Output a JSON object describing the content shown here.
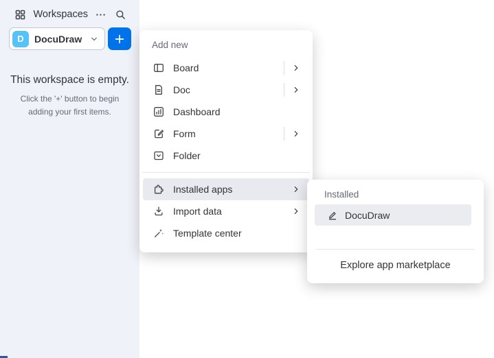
{
  "colors": {
    "accent_blue": "#0073ea",
    "avatar_blue": "#55c2f8",
    "sidebar_bg": "#eff2f8",
    "text_dark": "#323338",
    "text_gray": "#676879",
    "highlight_row": "#e9eaef"
  },
  "sidebar": {
    "workspaces_label": "Workspaces",
    "workspace_switcher": {
      "avatar_letter": "D",
      "name": "DocuDraw"
    },
    "empty_state": {
      "title": "This workspace is empty.",
      "subtitle_line1": "Click the '+' button to begin",
      "subtitle_line2": "adding your first items."
    }
  },
  "add_menu": {
    "header": "Add new",
    "items": [
      {
        "label": "Board",
        "icon": "board-icon",
        "has_submenu": true
      },
      {
        "label": "Doc",
        "icon": "doc-icon",
        "has_submenu": true
      },
      {
        "label": "Dashboard",
        "icon": "dashboard-icon",
        "has_submenu": false
      },
      {
        "label": "Form",
        "icon": "form-icon",
        "has_submenu": true
      },
      {
        "label": "Folder",
        "icon": "folder-icon",
        "has_submenu": false
      }
    ],
    "secondary_items": [
      {
        "label": "Installed apps",
        "icon": "puzzle-icon",
        "has_submenu": true,
        "highlighted": true
      },
      {
        "label": "Import data",
        "icon": "import-icon",
        "has_submenu": true
      },
      {
        "label": "Template center",
        "icon": "wand-icon",
        "has_submenu": false
      }
    ]
  },
  "installed_submenu": {
    "header": "Installed",
    "items": [
      {
        "label": "DocuDraw",
        "icon": "pencil-icon",
        "highlighted": true
      }
    ],
    "footer_link": "Explore app marketplace"
  }
}
